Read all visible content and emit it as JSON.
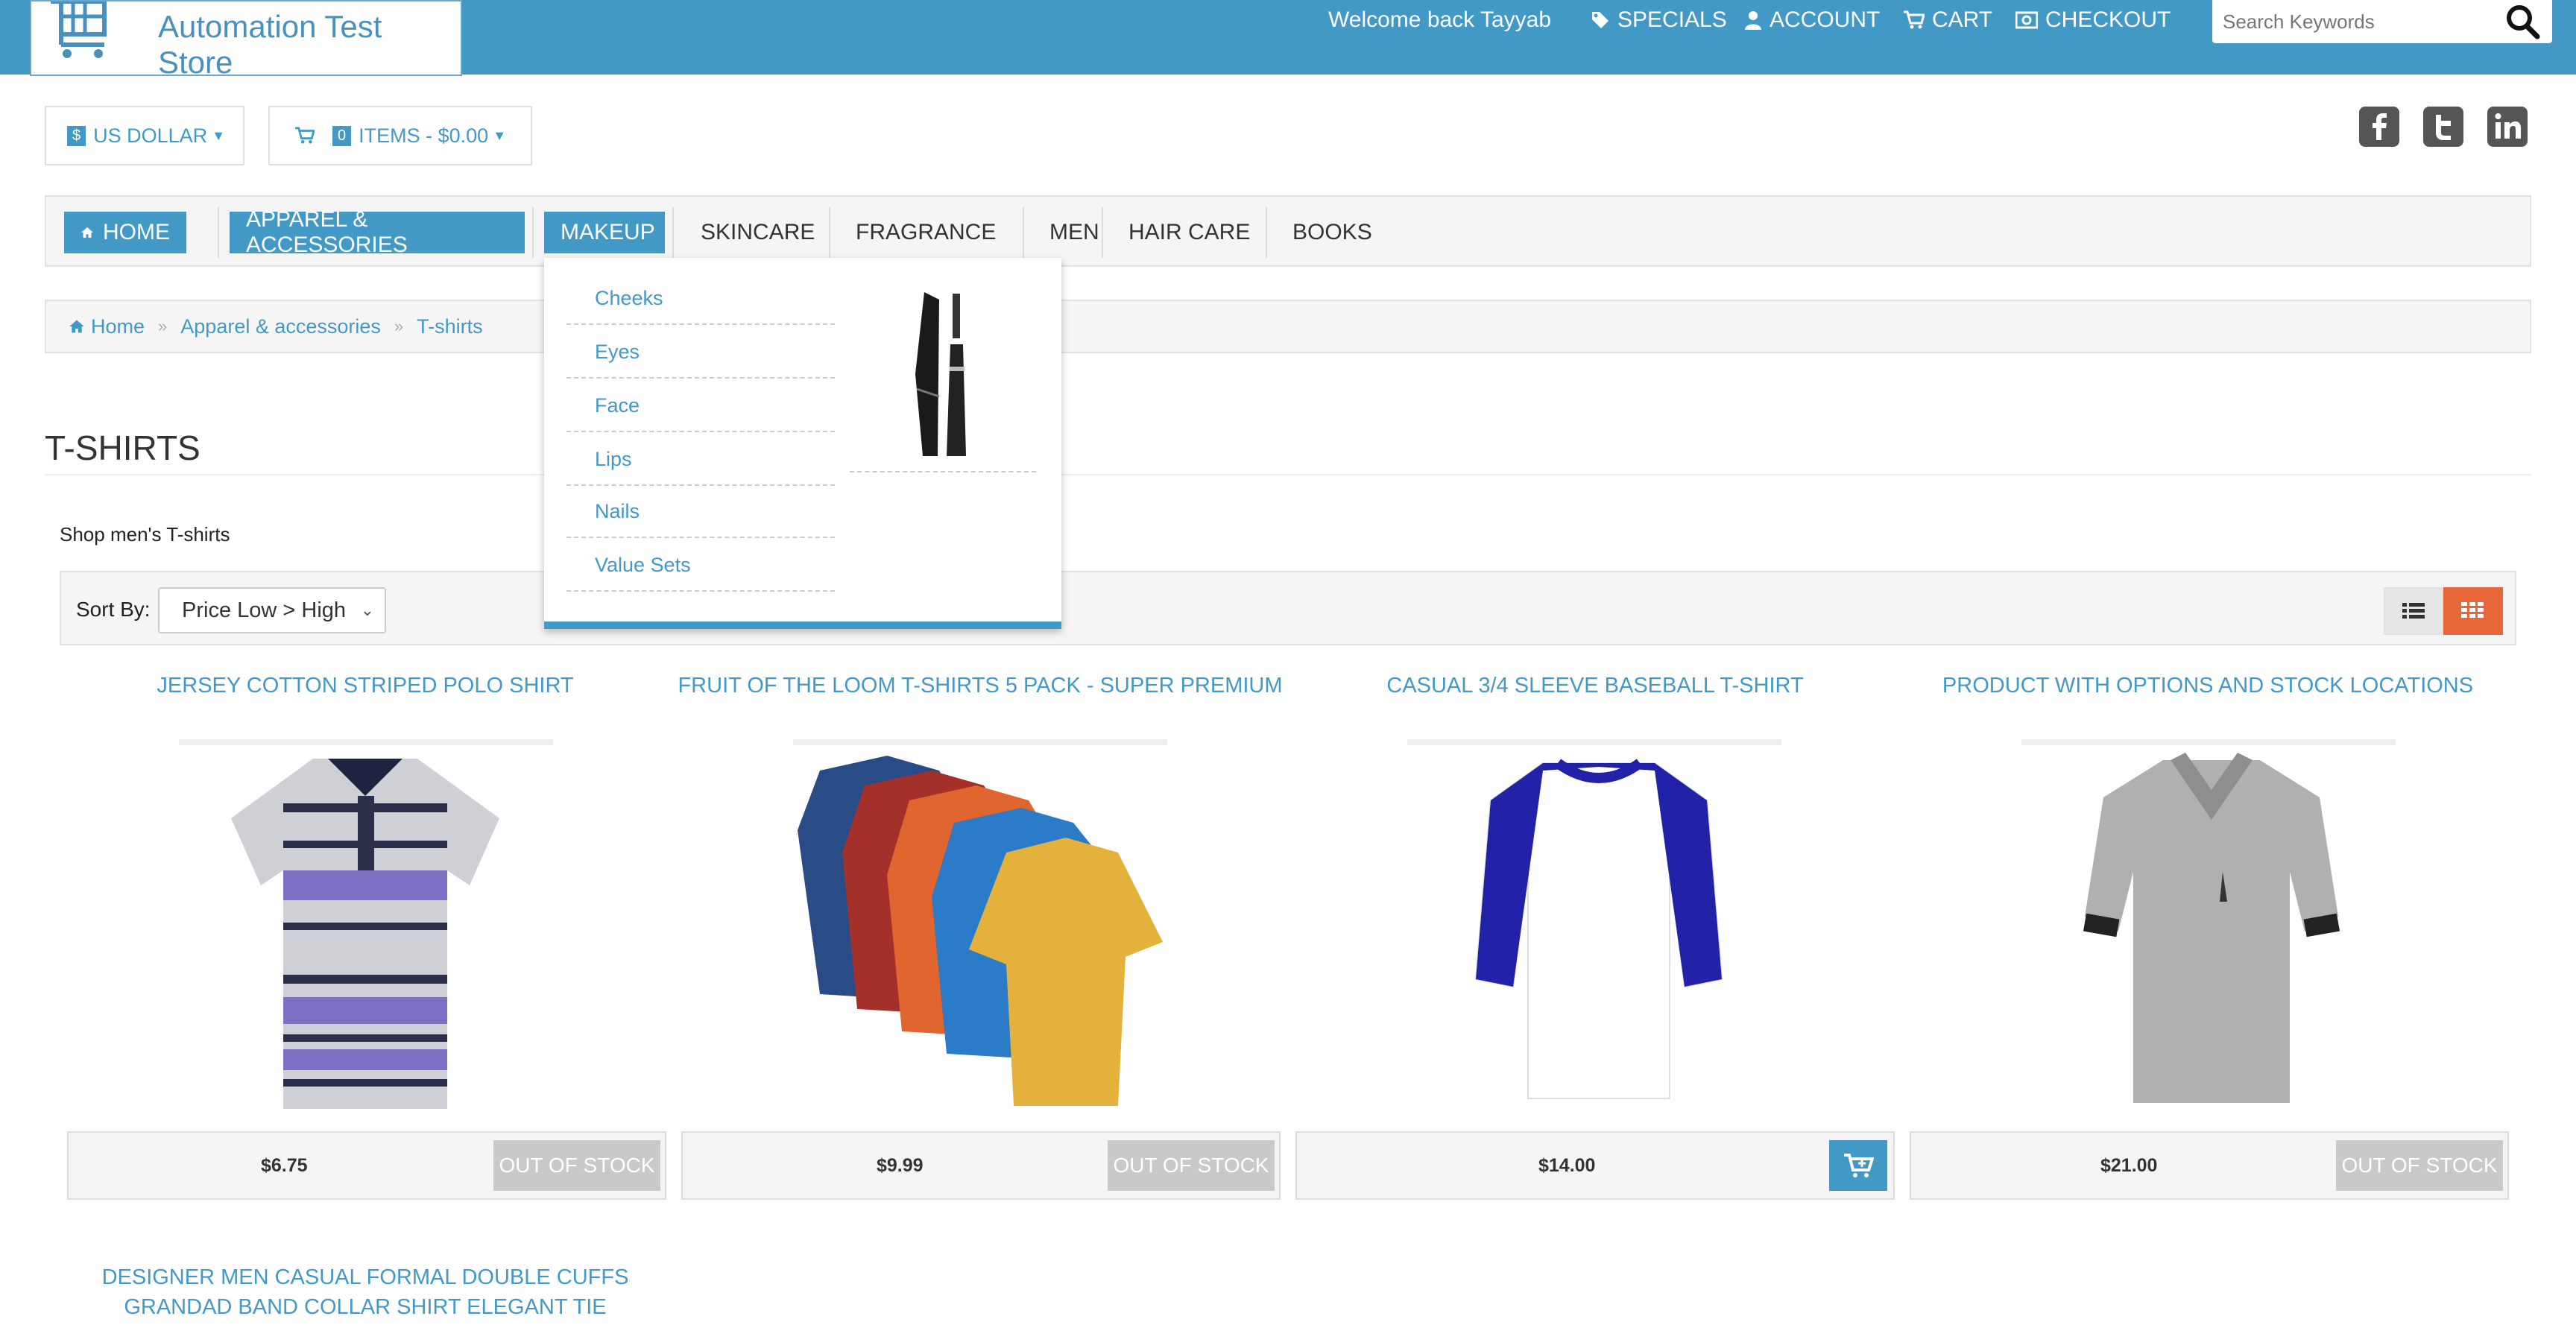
{
  "header": {
    "store_name": "Automation Test Store",
    "welcome": "Welcome back Tayyab",
    "nav": [
      {
        "label": "SPECIALS",
        "icon": "tag-icon"
      },
      {
        "label": "ACCOUNT",
        "icon": "user-icon"
      },
      {
        "label": "CART",
        "icon": "cart-icon"
      },
      {
        "label": "CHECKOUT",
        "icon": "checkout-icon"
      }
    ],
    "search_placeholder": "Search Keywords"
  },
  "currency": {
    "symbol": "$",
    "label": "US DOLLAR"
  },
  "cart_summary": {
    "count": "0",
    "label": "ITEMS - $0.00"
  },
  "social": [
    "facebook-icon",
    "twitter-icon",
    "linkedin-icon"
  ],
  "main_nav": [
    "HOME",
    "APPAREL & ACCESSORIES",
    "MAKEUP",
    "SKINCARE",
    "FRAGRANCE",
    "MEN",
    "HAIR CARE",
    "BOOKS"
  ],
  "dropdown": {
    "items": [
      "Cheeks",
      "Eyes",
      "Face",
      "Lips",
      "Nails",
      "Value Sets"
    ]
  },
  "breadcrumb": [
    "Home",
    "Apparel & accessories",
    "T-shirts"
  ],
  "page": {
    "title": "T-SHIRTS",
    "description": "Shop men's T-shirts"
  },
  "sort": {
    "label": "Sort By:",
    "value": "Price Low > High"
  },
  "products": [
    {
      "title": "JERSEY COTTON STRIPED POLO SHIRT",
      "price": "$6.75",
      "status": "OUT OF STOCK"
    },
    {
      "title": "FRUIT OF THE LOOM T-SHIRTS 5 PACK - SUPER PREMIUM",
      "price": "$9.99",
      "status": "OUT OF STOCK"
    },
    {
      "title": "CASUAL 3/4 SLEEVE BASEBALL T-SHIRT",
      "price": "$14.00",
      "status": ""
    },
    {
      "title": "PRODUCT WITH OPTIONS AND STOCK LOCATIONS",
      "price": "$21.00",
      "status": "OUT OF STOCK"
    },
    {
      "title": "DESIGNER MEN CASUAL FORMAL DOUBLE CUFFS GRANDAD BAND COLLAR SHIRT ELEGANT TIE",
      "price": "",
      "status": ""
    }
  ],
  "colors": {
    "accent": "#4299c6",
    "active_view": "#e8673a",
    "disabled": "#c9c9c9"
  }
}
